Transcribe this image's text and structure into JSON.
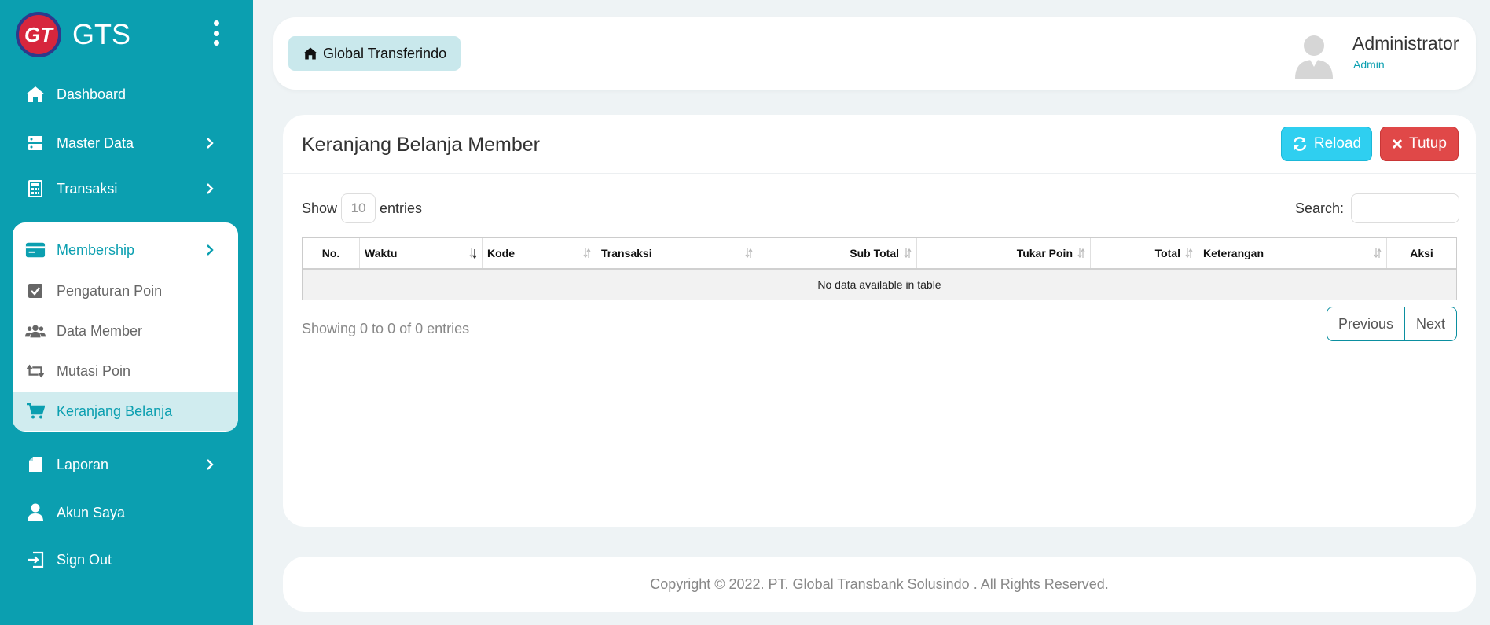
{
  "brand": {
    "name": "GTS",
    "logo_text": "GT"
  },
  "sidebar": {
    "items": [
      {
        "label": "Dashboard",
        "icon": "home-icon"
      },
      {
        "label": "Master Data",
        "icon": "server-icon"
      },
      {
        "label": "Transaksi",
        "icon": "calculator-icon"
      },
      {
        "label": "Membership",
        "icon": "credit-card-icon"
      },
      {
        "label": "Laporan",
        "icon": "file-icon"
      },
      {
        "label": "Akun Saya",
        "icon": "user-icon"
      },
      {
        "label": "Sign Out",
        "icon": "sign-out-icon"
      }
    ],
    "membership_sub": [
      {
        "label": "Pengaturan Poin",
        "icon": "check-square-icon"
      },
      {
        "label": "Data Member",
        "icon": "users-icon"
      },
      {
        "label": "Mutasi Poin",
        "icon": "retweet-icon"
      },
      {
        "label": "Keranjang Belanja",
        "icon": "shopping-cart-icon",
        "active": true
      }
    ]
  },
  "header": {
    "home_label": "Global Transferindo",
    "user_name": "Administrator",
    "user_role": "Admin"
  },
  "main": {
    "title": "Keranjang Belanja Member",
    "reload_label": "Reload",
    "close_label": "Tutup",
    "show_label": "Show",
    "entries_value": "10",
    "entries_label": "entries",
    "search_label": "Search:",
    "columns": [
      "No.",
      "Waktu",
      "Kode",
      "Transaksi",
      "Sub Total",
      "Tukar Poin",
      "Total",
      "Keterangan",
      "Aksi"
    ],
    "empty_message": "No data available in table",
    "info": "Showing 0 to 0 of 0 entries",
    "prev_label": "Previous",
    "next_label": "Next"
  },
  "footer": {
    "copyright": "Copyright © 2022. PT. Global Transbank Solusindo . All Rights Reserved."
  },
  "colors": {
    "sidebar": "#0b9fb0",
    "reload": "#2fcff0",
    "close": "#e04848",
    "active_bg": "#d0ecef"
  }
}
